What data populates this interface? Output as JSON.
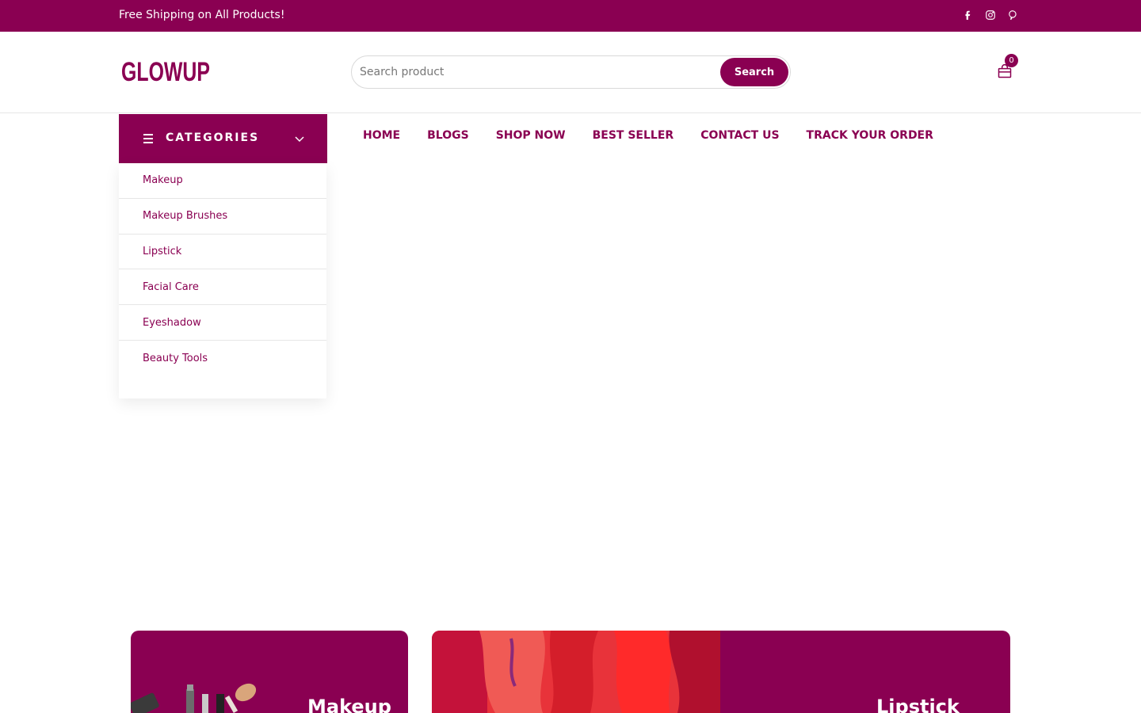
{
  "topbar": {
    "promo": "Free Shipping on All Products!",
    "social": [
      "facebook-icon",
      "instagram-icon",
      "pinterest-icon"
    ]
  },
  "header": {
    "logo_text": "GLOWUP",
    "search_placeholder": "Search product",
    "search_button": "Search",
    "cart_count": "0"
  },
  "categories": {
    "title": "CATEGORIES",
    "items": [
      "Makeup",
      "Makeup Brushes",
      "Lipstick",
      "Facial Care",
      "Eyeshadow",
      "Beauty Tools"
    ]
  },
  "nav": {
    "items": [
      "HOME",
      "BLOGS",
      "SHOP NOW",
      "BEST SELLER",
      "CONTACT US",
      "TRACK YOUR ORDER"
    ]
  },
  "banners": {
    "makeup": "Makeup",
    "lipstick": "Lipstick"
  },
  "colors": {
    "brand": "#8a0052"
  }
}
